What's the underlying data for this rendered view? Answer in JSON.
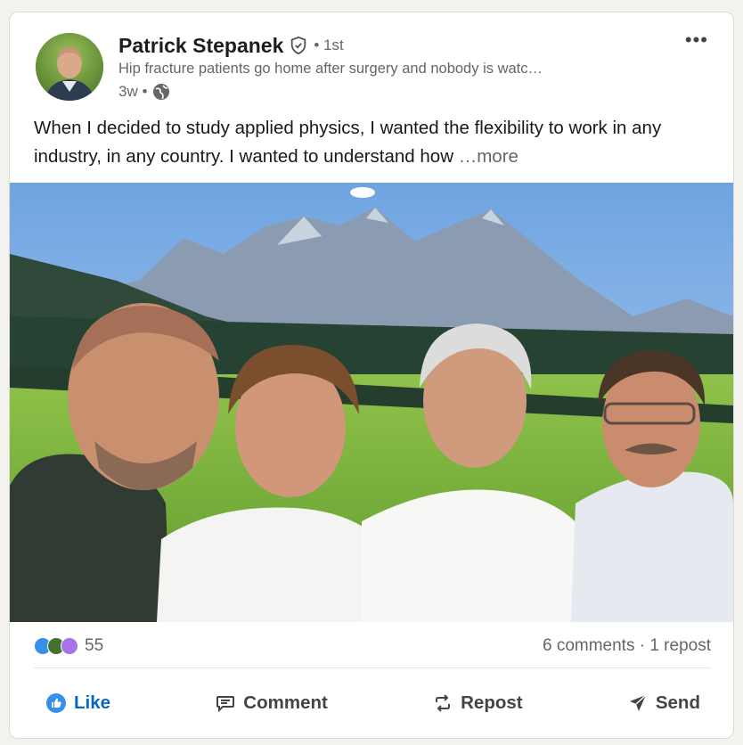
{
  "post": {
    "author": {
      "name": "Patrick Stepanek",
      "degree": "• 1st",
      "headline": "Hip fracture patients go home after surgery and nobody is watc…",
      "time": "3w •"
    },
    "text": "When I decided to study applied physics, I wanted the flexibility to work in any industry, in any country. I wanted to understand how",
    "more_label": "…more"
  },
  "social": {
    "reaction_count": "55",
    "comments_reposts": "6 comments · 1 repost",
    "reaction_icons": [
      "like-icon",
      "celebrate-icon",
      "support-icon"
    ]
  },
  "actions": {
    "like": "Like",
    "comment": "Comment",
    "repost": "Repost",
    "send": "Send"
  },
  "colors": {
    "accent": "#0a66c2",
    "text_muted": "#666666"
  }
}
